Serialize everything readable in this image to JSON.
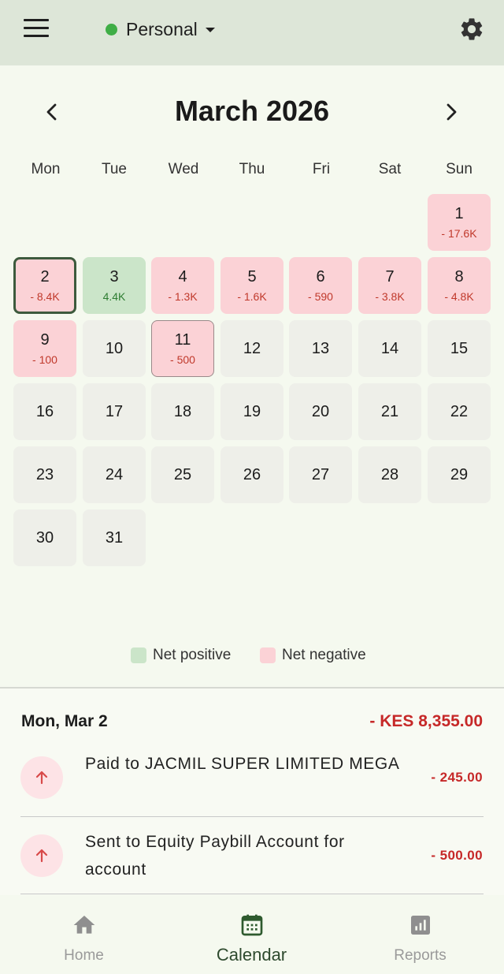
{
  "header": {
    "account_name": "Personal",
    "account_status_color": "#3fae46",
    "menu_icon": "hamburger-menu-icon",
    "settings_icon": "gear-icon"
  },
  "calendar": {
    "month_title": "March 2026",
    "prev_icon": "chevron-left-icon",
    "next_icon": "chevron-right-icon",
    "weekdays": [
      "Mon",
      "Tue",
      "Wed",
      "Thu",
      "Fri",
      "Sat",
      "Sun"
    ],
    "days": [
      {
        "day": "1",
        "amount": "- 17.6K",
        "status": "negative"
      },
      {
        "day": "2",
        "amount": "- 8.4K",
        "status": "negative",
        "selected": true
      },
      {
        "day": "3",
        "amount": "4.4K",
        "status": "positive"
      },
      {
        "day": "4",
        "amount": "- 1.3K",
        "status": "negative"
      },
      {
        "day": "5",
        "amount": "- 1.6K",
        "status": "negative"
      },
      {
        "day": "6",
        "amount": "- 590",
        "status": "negative"
      },
      {
        "day": "7",
        "amount": "- 3.8K",
        "status": "negative"
      },
      {
        "day": "8",
        "amount": "- 4.8K",
        "status": "negative"
      },
      {
        "day": "9",
        "amount": "- 100",
        "status": "negative"
      },
      {
        "day": "10",
        "amount": "",
        "status": "none"
      },
      {
        "day": "11",
        "amount": "- 500",
        "status": "negative",
        "today": true
      },
      {
        "day": "12",
        "amount": "",
        "status": "none"
      },
      {
        "day": "13",
        "amount": "",
        "status": "none"
      },
      {
        "day": "14",
        "amount": "",
        "status": "none"
      },
      {
        "day": "15",
        "amount": "",
        "status": "none"
      },
      {
        "day": "16",
        "amount": "",
        "status": "none"
      },
      {
        "day": "17",
        "amount": "",
        "status": "none"
      },
      {
        "day": "18",
        "amount": "",
        "status": "none"
      },
      {
        "day": "19",
        "amount": "",
        "status": "none"
      },
      {
        "day": "20",
        "amount": "",
        "status": "none"
      },
      {
        "day": "21",
        "amount": "",
        "status": "none"
      },
      {
        "day": "22",
        "amount": "",
        "status": "none"
      },
      {
        "day": "23",
        "amount": "",
        "status": "none"
      },
      {
        "day": "24",
        "amount": "",
        "status": "none"
      },
      {
        "day": "25",
        "amount": "",
        "status": "none"
      },
      {
        "day": "26",
        "amount": "",
        "status": "none"
      },
      {
        "day": "27",
        "amount": "",
        "status": "none"
      },
      {
        "day": "28",
        "amount": "",
        "status": "none"
      },
      {
        "day": "29",
        "amount": "",
        "status": "none"
      },
      {
        "day": "30",
        "amount": "",
        "status": "none"
      },
      {
        "day": "31",
        "amount": "",
        "status": "none"
      }
    ]
  },
  "legend": {
    "positive_label": "Net positive",
    "negative_label": "Net negative",
    "positive_color": "#cbe5c9",
    "negative_color": "#fbd2d6"
  },
  "details": {
    "date_label": "Mon, Mar 2",
    "total": "- KES 8,355.00",
    "transactions": [
      {
        "description": "Paid to JACMIL SUPER LIMITED MEGA",
        "amount": "- 245.00",
        "icon": "arrow-up-icon"
      },
      {
        "description": "Sent to Equity Paybill Account for account",
        "amount": "- 500.00",
        "icon": "arrow-up-icon"
      }
    ]
  },
  "bottom_nav": {
    "items": [
      {
        "label": "Home",
        "icon": "home-icon",
        "active": false
      },
      {
        "label": "Calendar",
        "icon": "calendar-icon",
        "active": true
      },
      {
        "label": "Reports",
        "icon": "bar-chart-icon",
        "active": false
      }
    ]
  }
}
